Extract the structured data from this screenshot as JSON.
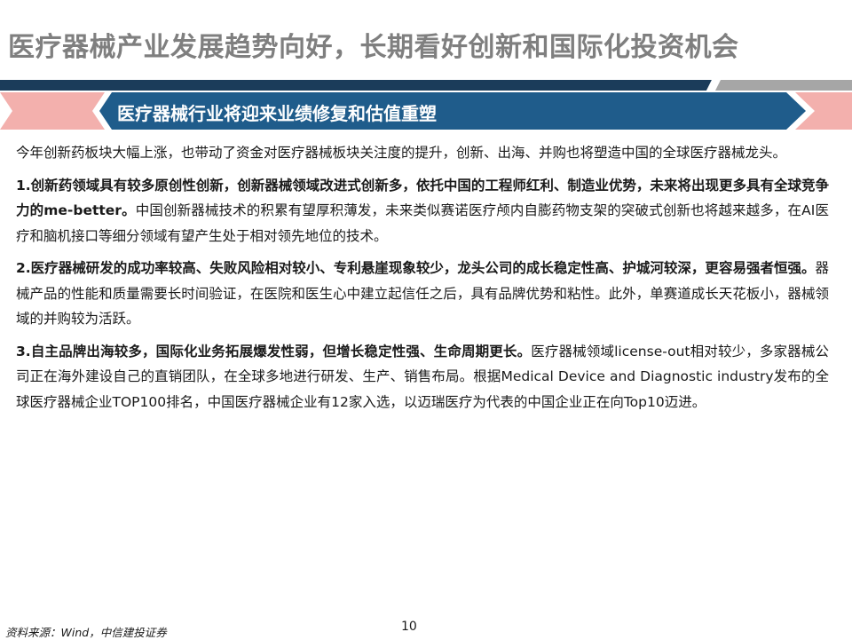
{
  "header": {
    "title": "医疗器械产业发展趋势向好，长期看好创新和国际化投资机会"
  },
  "banner": {
    "label": "医疗器械行业将迎来业绩修复和估值重塑"
  },
  "colors": {
    "title_text": "#7f7f7f",
    "banner_navy": "#1f5c8b",
    "accent_red": "#f3b0ad",
    "title_bar_dark": "#1b3c5a",
    "title_bar_grey": "#a6a6a6"
  },
  "content": {
    "intro": "今年创新药板块大幅上涨，也带动了资金对医疗器械板块关注度的提升，创新、出海、并购也将塑造中国的全球医疗器械龙头。",
    "points": [
      {
        "bold": "1.创新药领域具有较多原创性创新，创新器械领域改进式创新多，依托中国的工程师红利、制造业优势，未来将出现更多具有全球竞争力的me-better。",
        "text": "中国创新器械技术的积累有望厚积薄发，未来类似赛诺医疗颅内自膨药物支架的突破式创新也将越来越多，在AI医疗和脑机接口等细分领域有望产生处于相对领先地位的技术。"
      },
      {
        "bold": "2.医疗器械研发的成功率较高、失败风险相对较小、专利悬崖现象较少，龙头公司的成长稳定性高、护城河较深，更容易强者恒强。",
        "text": "器械产品的性能和质量需要长时间验证，在医院和医生心中建立起信任之后，具有品牌优势和粘性。此外，单赛道成长天花板小，器械领域的并购较为活跃。"
      },
      {
        "bold": "3.自主品牌出海较多，国际化业务拓展爆发性弱，但增长稳定性强、生命周期更长。",
        "text": "医疗器械领域license-out相对较少，多家器械公司正在海外建设自己的直销团队，在全球多地进行研发、生产、销售布局。根据Medical Device and Diagnostic industry发布的全球医疗器械企业TOP100排名，中国医疗器械企业有12家入选，以迈瑞医疗为代表的中国企业正在向Top10迈进。"
      }
    ]
  },
  "footer": {
    "source": "资料来源：Wind，中信建投证券",
    "page_number": "10"
  }
}
